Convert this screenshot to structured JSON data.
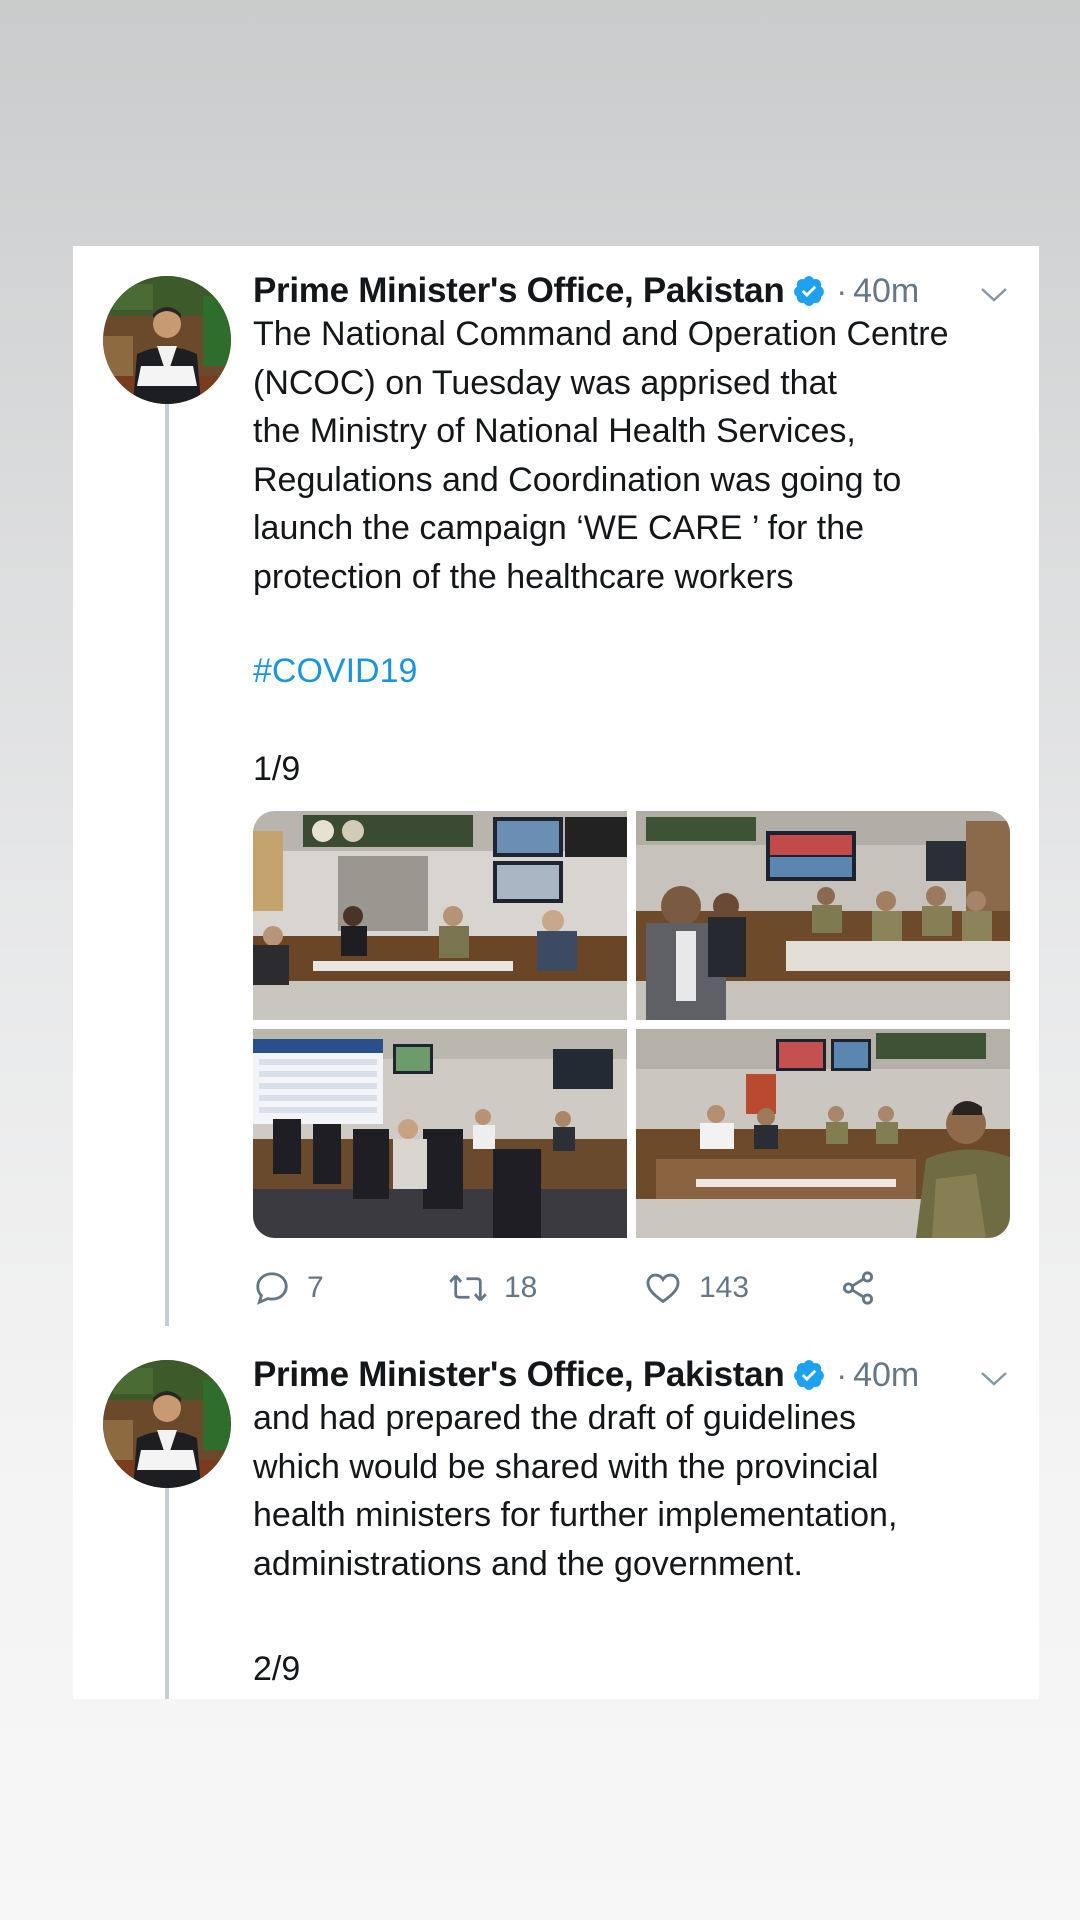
{
  "thread": [
    {
      "author": "Prime Minister's Office, Pakistan",
      "verified": true,
      "separator": "·",
      "time": "40m",
      "text_lines": [
        "The National Command and Operation Centre",
        "(NCOC) on Tuesday was apprised that",
        "the Ministry of National Health Services,",
        "Regulations and Coordination was going to",
        "launch the campaign ‘WE CARE ’ for the",
        "protection of the healthcare workers"
      ],
      "hashtag": "#COVID19",
      "counter": "1/9",
      "replies": "7",
      "retweets": "18",
      "likes": "143"
    },
    {
      "author": "Prime Minister's Office, Pakistan",
      "verified": true,
      "separator": "·",
      "time": "40m",
      "text_lines": [
        "and had prepared the draft of guidelines",
        "which would be shared with the provincial",
        "health ministers for further implementation,",
        "administrations and the government."
      ],
      "counter": "2/9"
    }
  ],
  "icons": {
    "verified": "verified-badge-icon",
    "caret": "chevron-down-icon",
    "reply": "reply-icon",
    "retweet": "retweet-icon",
    "like": "heart-icon",
    "share": "share-icon"
  },
  "colors": {
    "name": "#14171a",
    "meta": "#657786",
    "link": "#1b95e0",
    "verified": "#1da1f2",
    "thread_line": "#c5ced6",
    "scroll_indicator": "#8cc8f0"
  }
}
